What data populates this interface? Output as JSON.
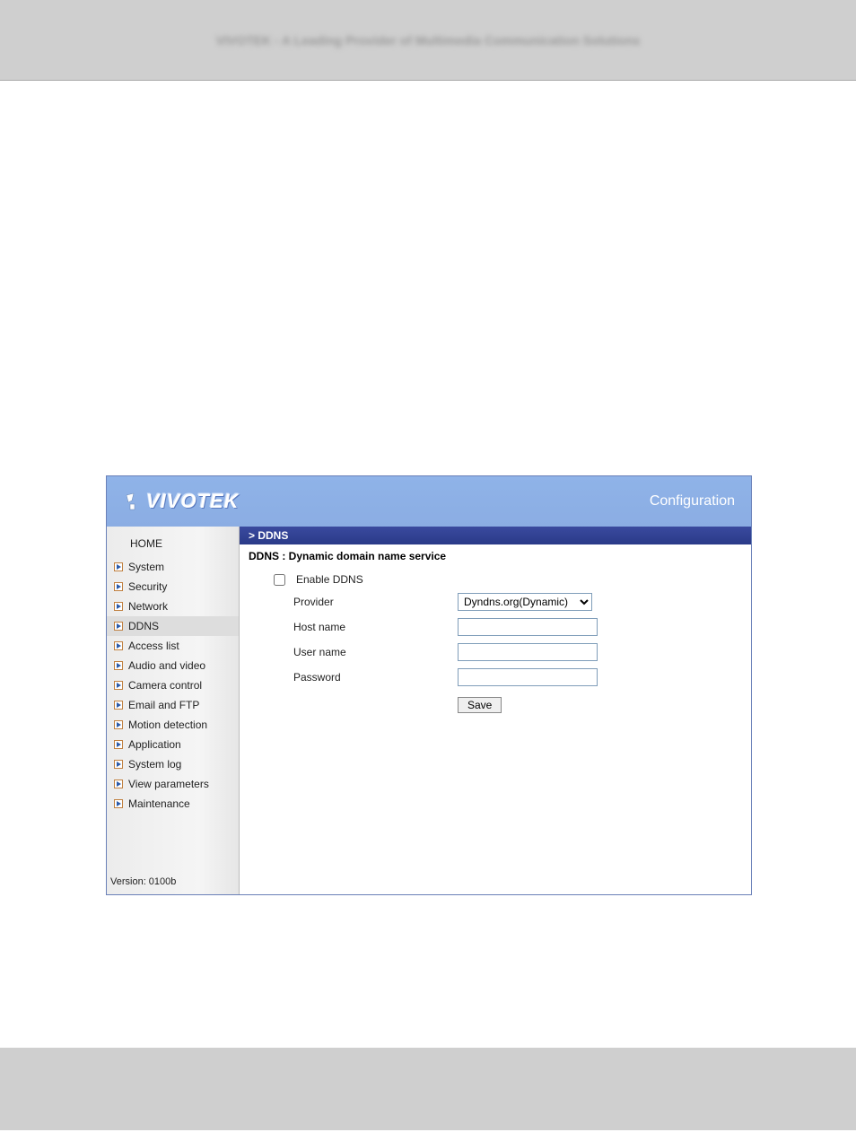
{
  "page_header_text": "VIVOTEK - A Leading Provider of Multimedia Communication Solutions",
  "header": {
    "brand": "VIVOTEK",
    "config_label": "Configuration"
  },
  "sidebar": {
    "home_label": "HOME",
    "items": [
      {
        "label": "System"
      },
      {
        "label": "Security"
      },
      {
        "label": "Network"
      },
      {
        "label": "DDNS"
      },
      {
        "label": "Access list"
      },
      {
        "label": "Audio and video"
      },
      {
        "label": "Camera control"
      },
      {
        "label": "Email and FTP"
      },
      {
        "label": "Motion detection"
      },
      {
        "label": "Application"
      },
      {
        "label": "System log"
      },
      {
        "label": "View parameters"
      },
      {
        "label": "Maintenance"
      }
    ],
    "version_label": "Version: 0100b"
  },
  "main": {
    "section_bar": "> DDNS",
    "section_title": "DDNS : Dynamic domain name service",
    "enable_ddns_label": "Enable DDNS",
    "fields": {
      "provider_label": "Provider",
      "provider_selected": "Dyndns.org(Dynamic)",
      "hostname_label": "Host name",
      "hostname_value": "",
      "username_label": "User name",
      "username_value": "",
      "password_label": "Password",
      "password_value": ""
    },
    "save_label": "Save"
  }
}
